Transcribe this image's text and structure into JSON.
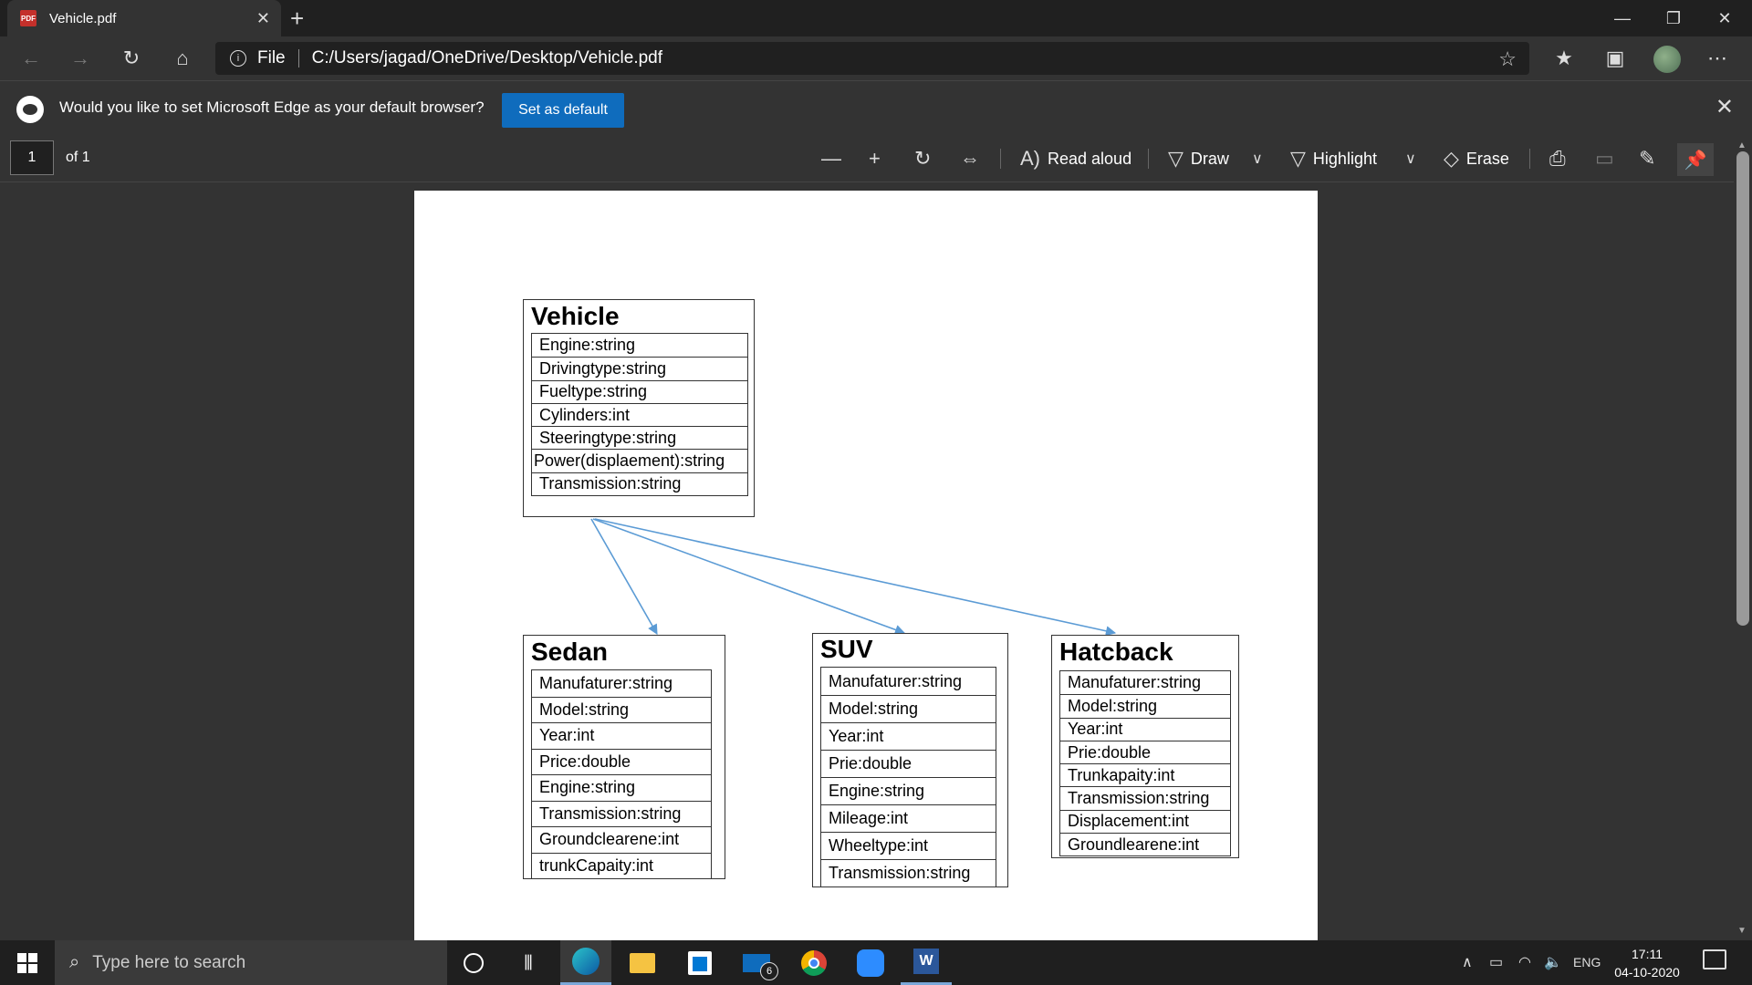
{
  "browser": {
    "tab_title": "Vehicle.pdf",
    "pdf_badge": "PDF",
    "url_scheme": "File",
    "url": "C:/Users/jagad/OneDrive/Desktop/Vehicle.pdf"
  },
  "banner": {
    "message": "Would you like to set Microsoft Edge as your default browser?",
    "set_default_label": "Set as default"
  },
  "pdf_toolbar": {
    "page_number": "1",
    "page_of": "of 1",
    "read_aloud": "Read aloud",
    "draw": "Draw",
    "highlight": "Highlight",
    "erase": "Erase"
  },
  "diagram": {
    "vehicle": {
      "name": "Vehicle",
      "attributes": [
        "Engine:string",
        "Drivingtype:string",
        "Fueltype:string",
        "Cylinders:int",
        "Steeringtype:string",
        "Power(displaement):string",
        "Transmission:string"
      ]
    },
    "sedan": {
      "name": "Sedan",
      "attributes": [
        "Manufaturer:string",
        "Model:string",
        "Year:int",
        "Price:double",
        "Engine:string",
        "Transmission:string",
        "Groundclearene:int",
        "trunkCapaity:int"
      ]
    },
    "suv": {
      "name": "SUV",
      "attributes": [
        "Manufaturer:string",
        "Model:string",
        "Year:int",
        "Prie:double",
        "Engine:string",
        "Mileage:int",
        "Wheeltype:int",
        "Transmission:string"
      ]
    },
    "hatchback": {
      "name": "Hatcback",
      "attributes": [
        "Manufaturer:string",
        "Model:string",
        "Year:int",
        "Prie:double",
        "Trunkapaity:int",
        "Transmission:string",
        "Displacement:int",
        "Groundlearene:int"
      ]
    }
  },
  "taskbar": {
    "search_placeholder": "Type here to search",
    "mail_badge": "6",
    "language": "ENG",
    "time": "17:11",
    "date": "04-10-2020"
  },
  "colors": {
    "arrow": "#5b9bd5",
    "accent_button": "#0f6cbd",
    "pdf_icon": "#c4302b"
  }
}
